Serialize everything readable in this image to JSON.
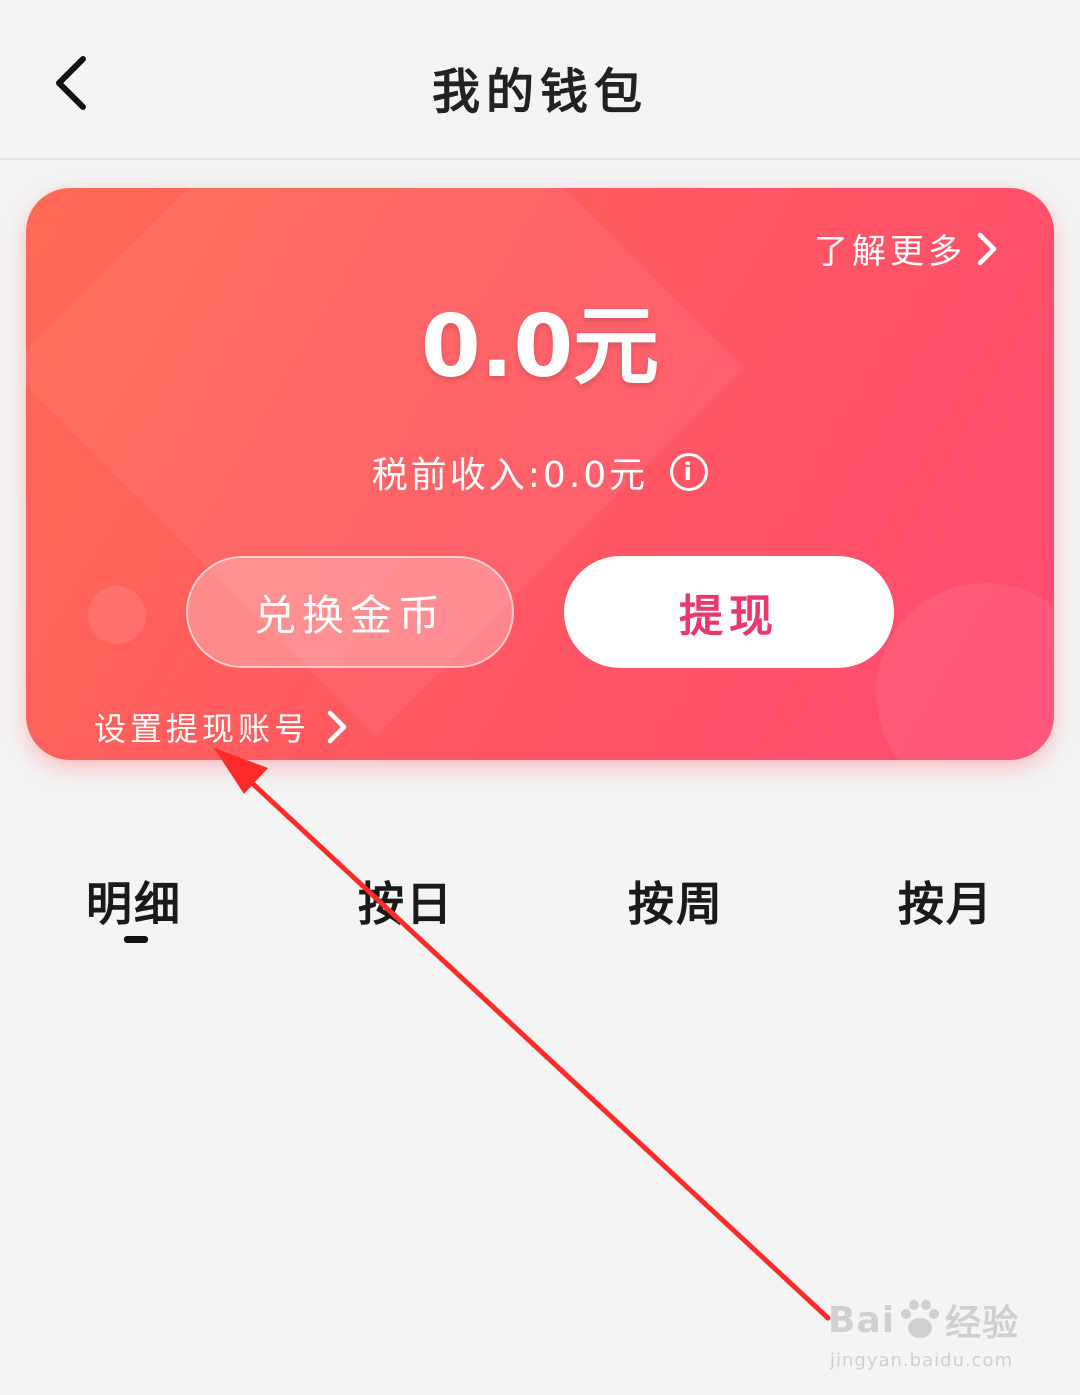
{
  "header": {
    "title": "我的钱包",
    "back_icon": "chevron-left-icon"
  },
  "wallet": {
    "learn_more": "了解更多",
    "balance": "0.0元",
    "pretax_label": "税前收入:0.0元",
    "info_icon_glyph": "i",
    "exchange_button": "兑换金币",
    "withdraw_button": "提现",
    "set_account_link": "设置提现账号",
    "colors": {
      "card_gradient_start": "#ff6a55",
      "card_gradient_end": "#ff4a72",
      "withdraw_text": "#e8386e"
    }
  },
  "tabs": [
    {
      "label": "明细",
      "active": true
    },
    {
      "label": "按日",
      "active": false
    },
    {
      "label": "按周",
      "active": false
    },
    {
      "label": "按月",
      "active": false
    }
  ],
  "watermark": {
    "brand_left": "Bai",
    "brand_right": "经验",
    "url": "jingyan.baidu.com"
  },
  "annotation": {
    "arrow_color": "#ff2a2a"
  }
}
